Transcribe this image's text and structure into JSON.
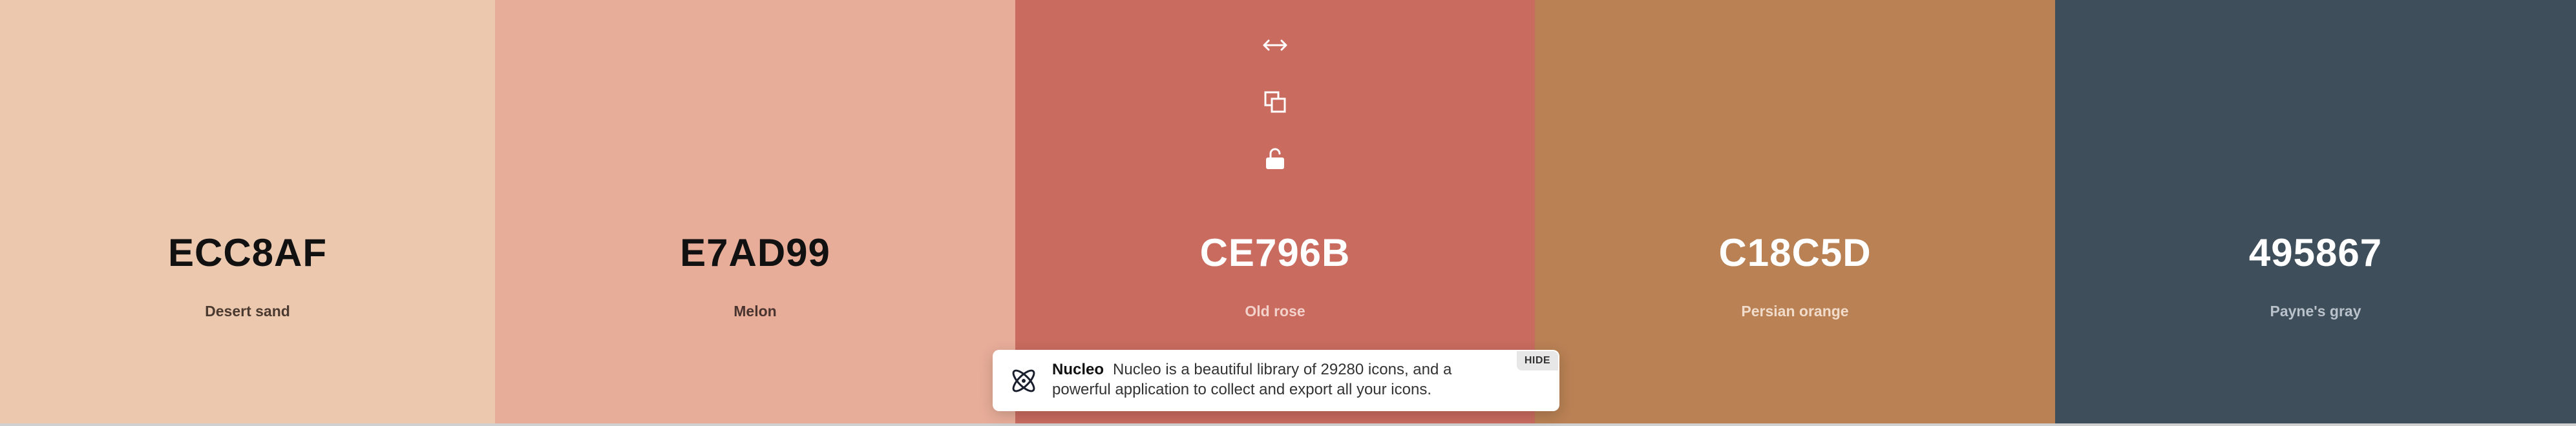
{
  "palette": {
    "colors": [
      {
        "hex": "ECC8AF",
        "name": "Desert sand",
        "bg": "#ECC8AF",
        "hex_color": "#111111",
        "name_color": "#4a3a30"
      },
      {
        "hex": "E7AD99",
        "name": "Melon",
        "bg": "#E7AD99",
        "hex_color": "#111111",
        "name_color": "#4a3430"
      },
      {
        "hex": "CE796B",
        "name": "Old rose",
        "bg": "#C96B5F",
        "hex_color": "#ffffff",
        "name_color": "#f3d2cc"
      },
      {
        "hex": "C18C5D",
        "name": "Persian orange",
        "bg": "#B98154",
        "hex_color": "#ffffff",
        "name_color": "#f1dccb"
      },
      {
        "hex": "495867",
        "name": "Payne's gray",
        "bg": "#3F4E5B",
        "hex_color": "#ffffff",
        "name_color": "#b9c2cb"
      }
    ],
    "active_tools": {
      "icons": [
        "drag-horizontal-icon",
        "copy-icon",
        "unlock-icon"
      ]
    }
  },
  "toast": {
    "brand": "Nucleo",
    "message": "Nucleo is a beautiful library of 29280 icons, and a powerful application to collect and export all your icons.",
    "hide_label": "HIDE",
    "logo_icon": "nucleo-logo-icon"
  }
}
